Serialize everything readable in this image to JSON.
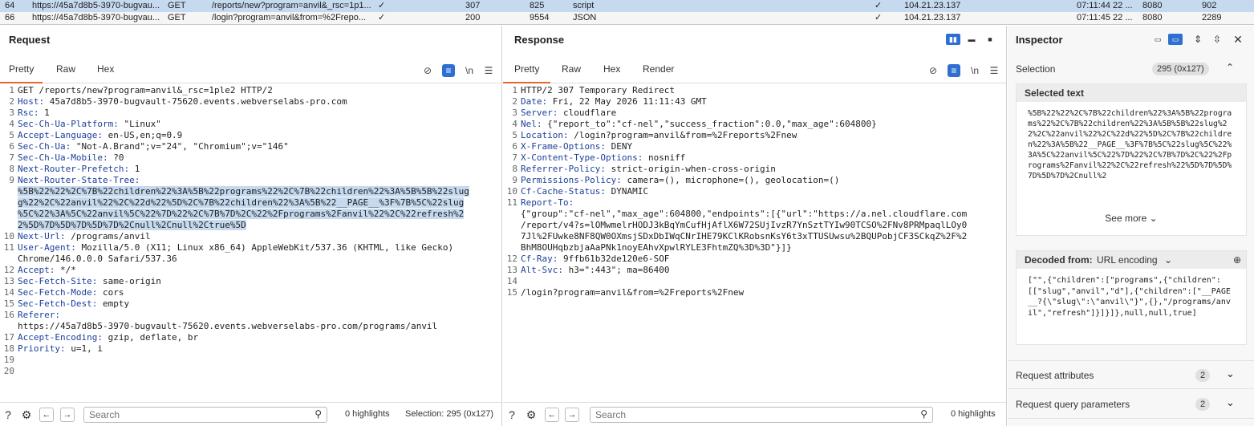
{
  "history": [
    {
      "num": "64",
      "url": "https://45a7d8b5-3970-bugvau...",
      "method": "GET",
      "path": "/reports/new?program=anvil&_rsc=1p1...",
      "params": "✓",
      "status": "307",
      "length": "825",
      "mime": "script",
      "tls": "✓",
      "ip": "104.21.23.137",
      "time": "07:11:44 22 ...",
      "port": "8080",
      "rtt": "902"
    },
    {
      "num": "66",
      "url": "https://45a7d8b5-3970-bugvau...",
      "method": "GET",
      "path": "/login?program=anvil&from=%2Frepo...",
      "params": "✓",
      "status": "200",
      "length": "9554",
      "mime": "JSON",
      "tls": "✓",
      "ip": "104.21.23.137",
      "time": "07:11:45 22 ...",
      "port": "8080",
      "rtt": "2289"
    }
  ],
  "request": {
    "title": "Request",
    "tabs": [
      "Pretty",
      "Raw",
      "Hex"
    ],
    "lines": [
      {
        "n": "1",
        "k": "",
        "v": "GET /reports/new?program=anvil&_rsc=1ple2 HTTP/2"
      },
      {
        "n": "2",
        "k": "Host:",
        "v": " 45a7d8b5-3970-bugvault-75620.events.webverselabs-pro.com"
      },
      {
        "n": "3",
        "k": "Rsc:",
        "v": " 1"
      },
      {
        "n": "4",
        "k": "Sec-Ch-Ua-Platform:",
        "v": " \"Linux\""
      },
      {
        "n": "5",
        "k": "Accept-Language:",
        "v": " en-US,en;q=0.9"
      },
      {
        "n": "6",
        "k": "Sec-Ch-Ua:",
        "v": " \"Not-A.Brand\";v=\"24\", \"Chromium\";v=\"146\""
      },
      {
        "n": "7",
        "k": "Sec-Ch-Ua-Mobile:",
        "v": " ?0"
      },
      {
        "n": "8",
        "k": "Next-Router-Prefetch:",
        "v": " 1"
      },
      {
        "n": "9",
        "k": "Next-Router-State-Tree:",
        "v": ""
      },
      {
        "n": "",
        "k": "",
        "v": "%5B%22%22%2C%7B%22children%22%3A%5B%22programs%22%2C%7B%22children%22%3A%5B%5B%22slug",
        "hl": true
      },
      {
        "n": "",
        "k": "",
        "v": "g%22%2C%22anvil%22%2C%22d%22%5D%2C%7B%22children%22%3A%5B%22__PAGE__%3F%7B%5C%22slug",
        "hl": true
      },
      {
        "n": "",
        "k": "",
        "v": "%5C%22%3A%5C%22anvil%5C%22%7D%22%2C%7B%7D%2C%22%2Fprograms%2Fanvil%22%2C%22refresh%2",
        "hl": true
      },
      {
        "n": "",
        "k": "",
        "v": "2%5D%7D%5D%7D%5D%7D%2Cnull%2Cnull%2Ctrue%5D",
        "hl": true
      },
      {
        "n": "10",
        "k": "Next-Url:",
        "v": " /programs/anvil"
      },
      {
        "n": "11",
        "k": "User-Agent:",
        "v": " Mozilla/5.0 (X11; Linux x86_64) AppleWebKit/537.36 (KHTML, like Gecko)"
      },
      {
        "n": "",
        "k": "",
        "v": "Chrome/146.0.0.0 Safari/537.36"
      },
      {
        "n": "12",
        "k": "Accept:",
        "v": " */*"
      },
      {
        "n": "13",
        "k": "Sec-Fetch-Site:",
        "v": " same-origin"
      },
      {
        "n": "14",
        "k": "Sec-Fetch-Mode:",
        "v": " cors"
      },
      {
        "n": "15",
        "k": "Sec-Fetch-Dest:",
        "v": " empty"
      },
      {
        "n": "16",
        "k": "Referer:",
        "v": ""
      },
      {
        "n": "",
        "k": "",
        "v": "https://45a7d8b5-3970-bugvault-75620.events.webverselabs-pro.com/programs/anvil"
      },
      {
        "n": "17",
        "k": "Accept-Encoding:",
        "v": " gzip, deflate, br"
      },
      {
        "n": "18",
        "k": "Priority:",
        "v": " u=1, i"
      },
      {
        "n": "19",
        "k": "",
        "v": ""
      },
      {
        "n": "20",
        "k": "",
        "v": ""
      }
    ],
    "search_placeholder": "Search",
    "highlights": "0 highlights",
    "selection": "Selection: 295 (0x127)"
  },
  "response": {
    "title": "Response",
    "tabs": [
      "Pretty",
      "Raw",
      "Hex",
      "Render"
    ],
    "lines": [
      {
        "n": "1",
        "k": "",
        "v": "HTTP/2 307 Temporary Redirect"
      },
      {
        "n": "2",
        "k": "Date:",
        "v": " Fri, 22 May 2026 11:11:43 GMT"
      },
      {
        "n": "3",
        "k": "Server:",
        "v": " cloudflare"
      },
      {
        "n": "4",
        "k": "Nel:",
        "v": " {\"report_to\":\"cf-nel\",\"success_fraction\":0.0,\"max_age\":604800}"
      },
      {
        "n": "5",
        "k": "Location:",
        "v": " /login?program=anvil&from=%2Freports%2Fnew"
      },
      {
        "n": "6",
        "k": "X-Frame-Options:",
        "v": " DENY"
      },
      {
        "n": "7",
        "k": "X-Content-Type-Options:",
        "v": " nosniff"
      },
      {
        "n": "8",
        "k": "Referrer-Policy:",
        "v": " strict-origin-when-cross-origin"
      },
      {
        "n": "9",
        "k": "Permissions-Policy:",
        "v": " camera=(), microphone=(), geolocation=()"
      },
      {
        "n": "10",
        "k": "Cf-Cache-Status:",
        "v": " DYNAMIC"
      },
      {
        "n": "11",
        "k": "Report-To:",
        "v": ""
      },
      {
        "n": "",
        "k": "",
        "v": "{\"group\":\"cf-nel\",\"max_age\":604800,\"endpoints\":[{\"url\":\"https://a.nel.cloudflare.com"
      },
      {
        "n": "",
        "k": "",
        "v": "/report/v4?s=lOMwmelrHODJ3kBqYmCufHjAflX6W72SUjIvzR7YnSztTYIw90TCSO%2FNv8PRMpaqlLOy0"
      },
      {
        "n": "",
        "k": "",
        "v": "7Jl%2FUwke8NF8QW0OXmsjSDxDbIWqCNrIHE79KClKRobsnKsY6t3xTTUSUwsu%2BQUPobjCF3SCkqZ%2F%2"
      },
      {
        "n": "",
        "k": "",
        "v": "BhM8OUHqbzbjaAaPNk1noyEAhvXpwlRYLE3FhtmZQ%3D%3D\"}]}"
      },
      {
        "n": "12",
        "k": "Cf-Ray:",
        "v": " 9ffb61b32de120e6-SOF"
      },
      {
        "n": "13",
        "k": "Alt-Svc:",
        "v": " h3=\":443\"; ma=86400"
      },
      {
        "n": "14",
        "k": "",
        "v": ""
      },
      {
        "n": "15",
        "k": "",
        "v": "/login?program=anvil&from=%2Freports%2Fnew"
      }
    ],
    "search_placeholder": "Search",
    "highlights": "0 highlights"
  },
  "inspector": {
    "title": "Inspector",
    "selection_label": "Selection",
    "selection_value": "295 (0x127)",
    "selected_text_label": "Selected text",
    "selected_text": "%5B%22%22%2C%7B%22children%22%3A%5B%22programs%22%2C%7B%22children%22%3A%5B%5B%22slug%22%2C%22anvil%22%2C%22d%22%5D%2C%7B%22children%22%3A%5B%22__PAGE__%3F%7B%5C%22slug%5C%22%3A%5C%22anvil%5C%22%7D%22%2C%7B%7D%2C%22%2Fprograms%2Fanvil%22%2C%22refresh%22%5D%7D%5D%7D%5D%7D%2Cnull%2",
    "see_more": "See more",
    "decoded_from_label": "Decoded from:",
    "decoded_from_value": "URL encoding",
    "decoded_text": "[\"\",{\"children\":[\"programs\",{\"children\":[[\"slug\",\"anvil\",\"d\"],{\"children\":[\"__PAGE__?{\\\"slug\\\":\\\"anvil\\\"}\",{},\"/programs/anvil\",\"refresh\"]}]}]},null,null,true]",
    "request_attributes_label": "Request attributes",
    "request_attributes_count": "2",
    "request_query_label": "Request query parameters",
    "request_query_count": "2"
  }
}
